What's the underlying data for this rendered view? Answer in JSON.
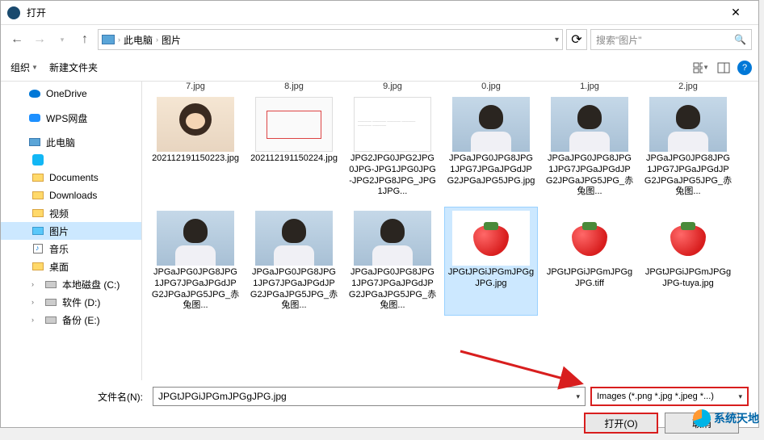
{
  "title": "打开",
  "breadcrumb": {
    "root": "此电脑",
    "folder": "图片"
  },
  "search": {
    "placeholder": "搜索\"图片\""
  },
  "toolbar": {
    "organize": "组织",
    "newfolder": "新建文件夹"
  },
  "sidebar": {
    "onedrive": "OneDrive",
    "wps": "WPS网盘",
    "thispc": "此电脑",
    "qq": "",
    "documents": "Documents",
    "downloads": "Downloads",
    "videos": "视频",
    "pictures": "图片",
    "music": "音乐",
    "desktop": "桌面",
    "diskc": "本地磁盘 (C:)",
    "diskd": "软件 (D:)",
    "diske": "备份 (E:)"
  },
  "partial_row": [
    "7.jpg",
    "8.jpg",
    "9.jpg",
    "0.jpg",
    "1.jpg",
    "2.jpg"
  ],
  "files": [
    {
      "name": "202112191150223.jpg",
      "thumb": "girl"
    },
    {
      "name": "202112191150224.jpg",
      "thumb": "doc"
    },
    {
      "name": "JPG2JPG0JPG2JPG0JPG-JPG1JPG0JPG-JPG2JPG8JPG_JPG1JPG...",
      "thumb": "text"
    },
    {
      "name": "JPGaJPG0JPG8JPG1JPG7JPGaJPGdJPG2JPGaJPG5JPG.jpg",
      "thumb": "boy"
    },
    {
      "name": "JPGaJPG0JPG8JPG1JPG7JPGaJPGdJPG2JPGaJPG5JPG_赤兔图...",
      "thumb": "boy"
    },
    {
      "name": "JPGaJPG0JPG8JPG1JPG7JPGaJPGdJPG2JPGaJPG5JPG_赤兔图...",
      "thumb": "boy"
    },
    {
      "name": "JPGaJPG0JPG8JPG1JPG7JPGaJPGdJPG2JPGaJPG5JPG_赤兔图...",
      "thumb": "boy"
    },
    {
      "name": "JPGaJPG0JPG8JPG1JPG7JPGaJPGdJPG2JPGaJPG5JPG_赤兔图...",
      "thumb": "boy"
    },
    {
      "name": "JPGaJPG0JPG8JPG1JPG7JPGaJPGdJPG2JPGaJPG5JPG_赤兔图...",
      "thumb": "boy"
    },
    {
      "name": "JPGtJPGiJPGmJPGgJPG.jpg",
      "thumb": "straw",
      "selected": true
    },
    {
      "name": "JPGtJPGiJPGmJPGgJPG.tiff",
      "thumb": "straw"
    },
    {
      "name": "JPGtJPGiJPGmJPGgJPG-tuya.jpg",
      "thumb": "straw"
    }
  ],
  "filename": {
    "label": "文件名(N):",
    "value": "JPGtJPGiJPGmJPGgJPG.jpg"
  },
  "filetype": {
    "value": "Images (*.png *.jpg *.jpeg *...)"
  },
  "buttons": {
    "open": "打开(O)",
    "cancel": "取消"
  },
  "watermark": "系统天地"
}
